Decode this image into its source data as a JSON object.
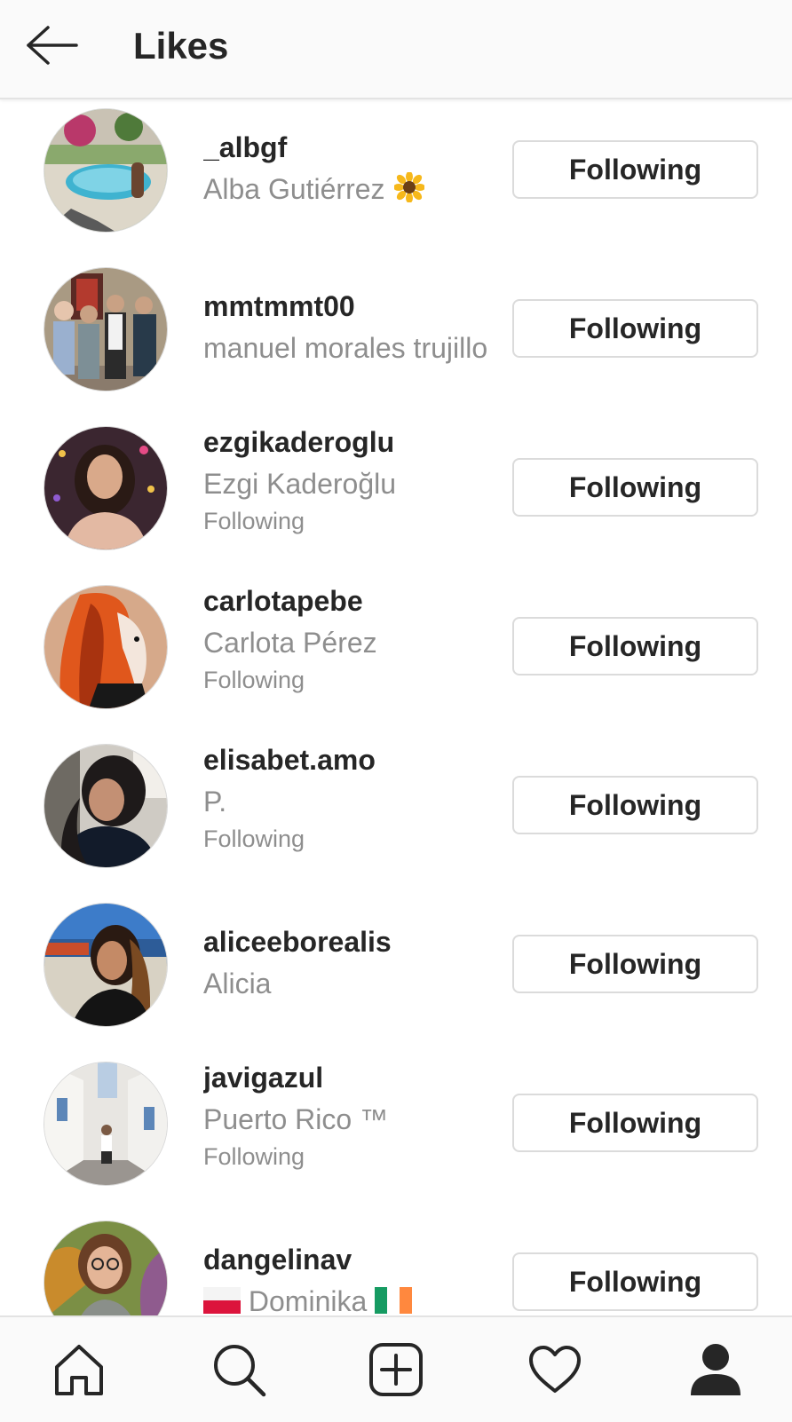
{
  "header": {
    "title": "Likes",
    "back_icon": "arrow-left-icon"
  },
  "colors": {
    "text": "#262626",
    "secondary": "#8e8e8e",
    "border": "#dbdbdb",
    "bar": "#fafafa"
  },
  "users": [
    {
      "username": "_albgf",
      "full_name": "Alba Gutiérrez",
      "emoji": "sunflower-icon",
      "follows_you": "",
      "button": "Following"
    },
    {
      "username": "mmtmmt00",
      "full_name": "manuel morales trujillo",
      "follows_you": "",
      "button": "Following"
    },
    {
      "username": "ezgikaderoglu",
      "full_name": "Ezgi Kaderoğlu",
      "follows_you": "Following",
      "button": "Following"
    },
    {
      "username": "carlotapebe",
      "full_name": "Carlota Pérez",
      "follows_you": "Following",
      "button": "Following"
    },
    {
      "username": "elisabet.amo",
      "full_name": "P.",
      "follows_you": "Following",
      "button": "Following"
    },
    {
      "username": "aliceeborealis",
      "full_name": "Alicia",
      "follows_you": "",
      "button": "Following"
    },
    {
      "username": "javigazul",
      "full_name": "Puerto Rico ™",
      "follows_you": "Following",
      "button": "Following"
    },
    {
      "username": "dangelinav",
      "full_name": "Dominika",
      "flags": [
        "poland-flag-icon",
        "ireland-flag-icon"
      ],
      "follows_you": "",
      "button": "Following"
    }
  ],
  "bottom_nav": [
    "home-icon",
    "search-icon",
    "new-post-icon",
    "activity-heart-icon",
    "profile-icon"
  ]
}
